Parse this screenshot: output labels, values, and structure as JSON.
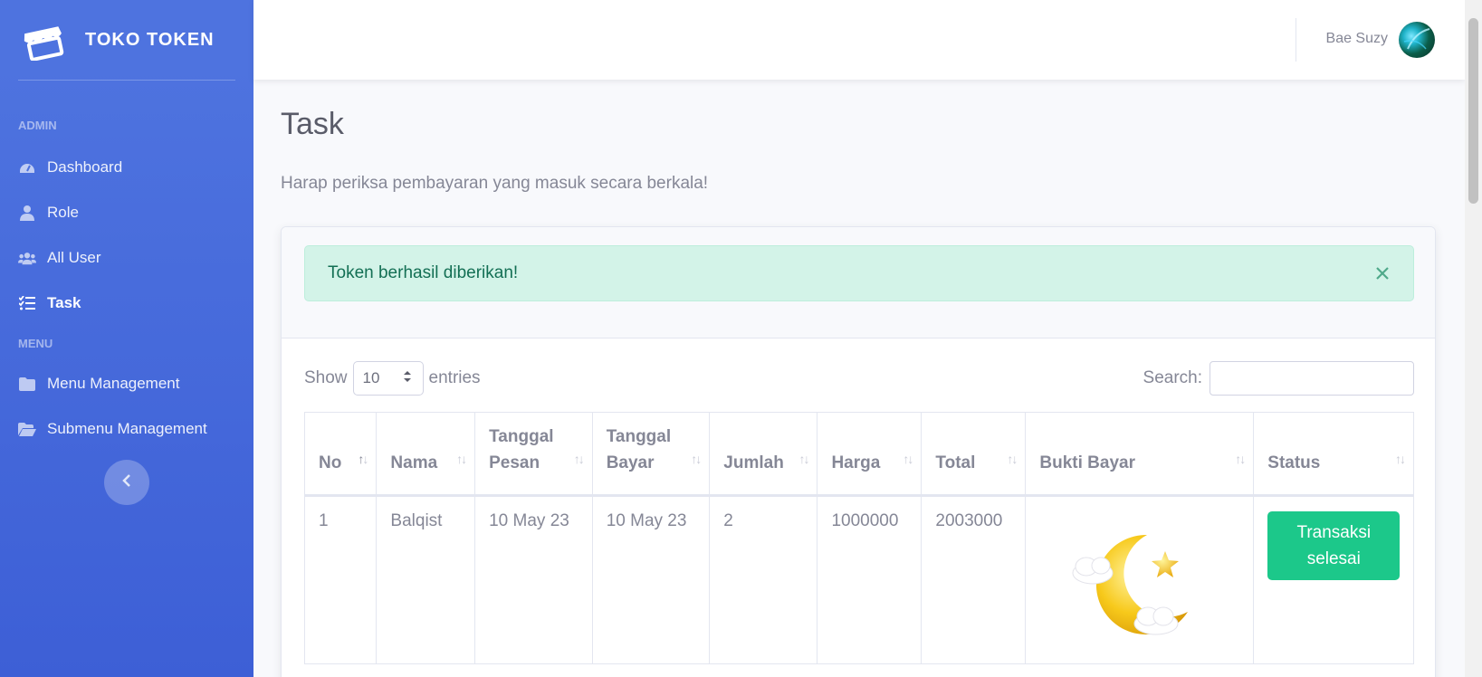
{
  "sidebar": {
    "brand": "TOKO TOKEN",
    "sections": [
      {
        "heading": "ADMIN"
      },
      {
        "heading": "MENU"
      }
    ],
    "items": [
      {
        "label": "Dashboard",
        "icon": "tachometer-icon"
      },
      {
        "label": "Role",
        "icon": "user-tie-icon"
      },
      {
        "label": "All User",
        "icon": "users-icon"
      },
      {
        "label": "Task",
        "icon": "tasks-icon",
        "active": true
      },
      {
        "label": "Menu Management",
        "icon": "folder-icon"
      },
      {
        "label": "Submenu Management",
        "icon": "folder-open-icon"
      }
    ],
    "toggle_icon": "chevron-left-icon"
  },
  "topbar": {
    "user_name": "Bae Suzy"
  },
  "page": {
    "title": "Task",
    "subtitle": "Harap periksa pembayaran yang masuk secara berkala!"
  },
  "alert": {
    "message": "Token berhasil diberikan!",
    "color": "#d3f3e8"
  },
  "datatable": {
    "show_label": "Show",
    "entries_value": "10",
    "entries_label": "entries",
    "search_label": "Search:",
    "columns": [
      "No",
      "Nama",
      "Tanggal Pesan",
      "Tanggal Bayar",
      "Jumlah",
      "Harga",
      "Total",
      "Bukti Bayar",
      "Status"
    ],
    "rows": [
      {
        "no": "1",
        "nama": "Balqist",
        "tanggal_pesan": "10 May 23",
        "tanggal_bayar": "10 May 23",
        "jumlah": "2",
        "harga": "1000000",
        "total": "2003000",
        "bukti_bayar": "moon-star-cloud-image",
        "status": "Transaksi selesai"
      }
    ]
  },
  "colors": {
    "sidebar": "#4e73df",
    "success": "#1cc88a"
  }
}
